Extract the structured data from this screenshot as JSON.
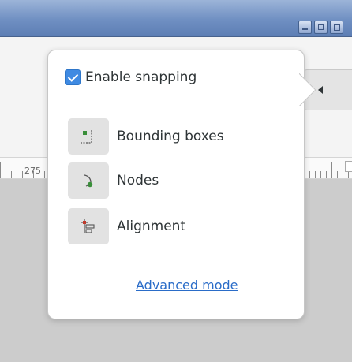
{
  "window": {
    "buttons": [
      {
        "name": "minimize-button"
      },
      {
        "name": "maximize-button"
      },
      {
        "name": "close-button"
      }
    ]
  },
  "ruler": {
    "visible_tick_label": "275"
  },
  "snapping_popover": {
    "enable_snapping": {
      "label": "Enable snapping",
      "checked": true
    },
    "options": [
      {
        "label": "Bounding boxes",
        "icon": "bounding-box-snap-icon"
      },
      {
        "label": "Nodes",
        "icon": "node-snap-icon"
      },
      {
        "label": "Alignment",
        "icon": "alignment-snap-icon"
      }
    ],
    "advanced_mode_link": "Advanced mode"
  },
  "colors": {
    "checkbox_accent": "#3f8ae2",
    "link": "#2a6cc8",
    "node_icon_green": "#3a8f3a"
  }
}
